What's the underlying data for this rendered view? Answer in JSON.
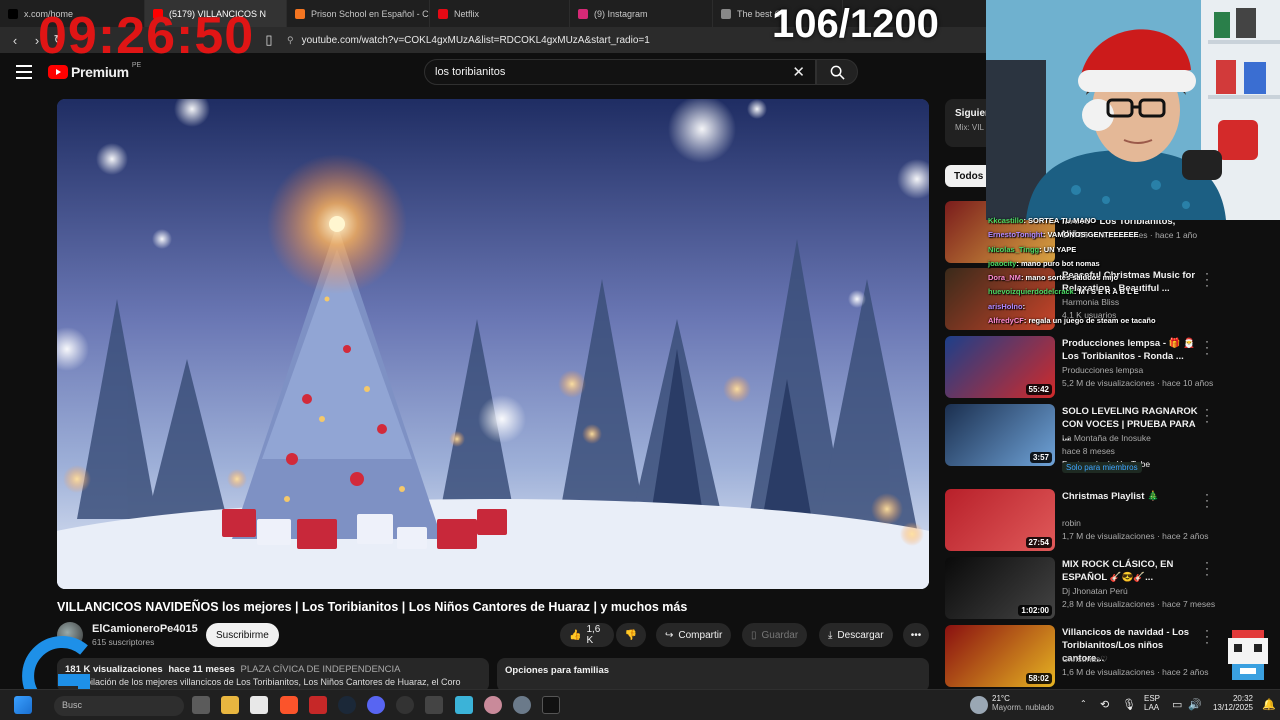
{
  "browser": {
    "tabs": [
      {
        "label": "x.com/home",
        "color": "#000000",
        "icon": "x-icon"
      },
      {
        "label": "(5179) VILLANCICOS N",
        "color": "#ff0000",
        "icon": "youtube-icon",
        "active": true
      },
      {
        "label": "Prison School en Español - Cru",
        "color": "#f47521",
        "icon": "crunchyroll-icon"
      },
      {
        "label": "Netflix",
        "color": "#e50914",
        "icon": "netflix-icon"
      },
      {
        "label": "(9) Instagram",
        "color": "#d62976",
        "icon": "instagram-icon"
      },
      {
        "label": "The best Ch",
        "color": "#888888",
        "icon": "generic-page-icon"
      }
    ],
    "url": "youtube.com/watch?v=COKL4gxMUzA&list=RDCOKL4gxMUzA&start_radio=1"
  },
  "stream_overlay": {
    "clock": "09:26:50",
    "counter": "106/1200"
  },
  "youtube": {
    "logo_text": "Premium",
    "country_code": "PE",
    "search_query": "los toribianitos",
    "video": {
      "title": "VILLANCICOS NAVIDEÑOS los mejores | Los Toribianitos | Los Niños Cantores de Huaraz | y muchos más",
      "channel": "ElCamioneroPe4015",
      "subscribers": "615 suscriptores",
      "subscribe_label": "Suscribirme",
      "likes": "1,6 K",
      "share_label": "Compartir",
      "save_label": "Guardar",
      "download_label": "Descargar",
      "views": "181 K visualizaciones",
      "age": "hace 11 meses",
      "location": "PLAZA CÍVICA DE INDEPENDENCIA",
      "description": "Recopilación de los mejores villancicos de Los Toribianitos, Los Niños Cantores de Huaraz, el Coro",
      "family_options": "Opciones para familias"
    },
    "sidebar": {
      "next_label": "Siguien",
      "mix_label": "Mix: VIL",
      "chip_all": "Todos",
      "recommendations": [
        {
          "title": "VILLANCICOS - SORTEA TU MANO - Los Toribianitos, Niños ...",
          "channel": "",
          "meta": "1 M de visualizaciones · hace 1 año",
          "duration": "",
          "colors": [
            "#7a1c1c",
            "#d9a441"
          ]
        },
        {
          "title": "Peaceful Christmas Music for Relaxation - Beautiful ...",
          "channel": "Harmonia Bliss",
          "meta": "4,1 K usuarios",
          "duration": "",
          "colors": [
            "#3a2a1a",
            "#c9442a"
          ]
        },
        {
          "title": "Producciones lempsa - 🎁 🎅 Los Toribianitos - Ronda ...",
          "channel": "Producciones lempsa",
          "meta": "5,2 M de visualizaciones · hace 10 años",
          "duration": "55:42",
          "colors": [
            "#1c3f8a",
            "#d12a2a"
          ]
        },
        {
          "title": "SOLO LEVELING RAGNAROK CON VOCES | PRUEBA PARA ...",
          "channel": "La Montaña de Inosuke",
          "meta": "hace 8 meses",
          "extra": "Destacado de YouTube",
          "badge": "Solo para miembros",
          "duration": "3:57",
          "colors": [
            "#1b2f4f",
            "#6fa3d8"
          ]
        },
        {
          "title": "Christmas Playlist 🎄",
          "channel": "robin",
          "meta": "1,7 M de visualizaciones · hace 2 años",
          "duration": "27:54",
          "colors": [
            "#b8202a",
            "#e05a5a"
          ]
        },
        {
          "title": "MIX ROCK CLÁSICO, EN ESPAÑOL 🎸😎🎸...",
          "channel": "Dj Jhonatan Perú",
          "meta": "2,8 M de visualizaciones · hace 7 meses",
          "duration": "1:02:00",
          "colors": [
            "#0a0a0a",
            "#444444"
          ]
        },
        {
          "title": "Villancicos de navidad - Los Toribianitos/Los niños cantore...",
          "channel": "Christmas♡",
          "meta": "1,6 M de visualizaciones · hace 2 años",
          "duration": "58:02",
          "colors": [
            "#8a1010",
            "#e6b422"
          ]
        }
      ]
    }
  },
  "chat": [
    {
      "user": "Kkcastillo",
      "text": "SORTEA TU MANO"
    },
    {
      "user": "ErnestoTonight",
      "text": "VAMONOS GENTEEEEEE"
    },
    {
      "user": "Nicolas_Tingg",
      "text": "UN YAPE"
    },
    {
      "user": "joaocity",
      "text": "mano puro bot nomas"
    },
    {
      "user": "Dora_NM",
      "text": "mano sortes saludos mijo"
    },
    {
      "user": "huevoizquierdodelcrack",
      "text": "M I S E R A B L E"
    },
    {
      "user": "arisHolno",
      "text": ""
    },
    {
      "user": "AlfredyCF",
      "text": "regala un juego de steam oe tacaño"
    }
  ],
  "taskbar": {
    "search_placeholder": "Busc",
    "weather_temp": "21°C",
    "weather_desc": "Mayorm. nublado",
    "lang": "ESP",
    "lang2": "LAA",
    "time": "20:32",
    "date": "13/12/2025"
  }
}
